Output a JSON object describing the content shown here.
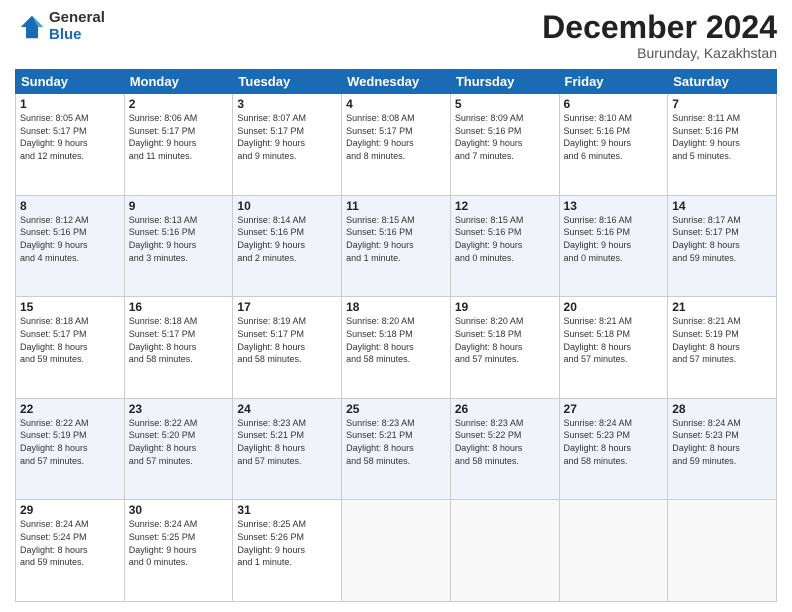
{
  "logo": {
    "general": "General",
    "blue": "Blue"
  },
  "header": {
    "month": "December 2024",
    "location": "Burunday, Kazakhstan"
  },
  "days_of_week": [
    "Sunday",
    "Monday",
    "Tuesday",
    "Wednesday",
    "Thursday",
    "Friday",
    "Saturday"
  ],
  "weeks": [
    [
      {
        "day": "1",
        "info": "Sunrise: 8:05 AM\nSunset: 5:17 PM\nDaylight: 9 hours\nand 12 minutes."
      },
      {
        "day": "2",
        "info": "Sunrise: 8:06 AM\nSunset: 5:17 PM\nDaylight: 9 hours\nand 11 minutes."
      },
      {
        "day": "3",
        "info": "Sunrise: 8:07 AM\nSunset: 5:17 PM\nDaylight: 9 hours\nand 9 minutes."
      },
      {
        "day": "4",
        "info": "Sunrise: 8:08 AM\nSunset: 5:17 PM\nDaylight: 9 hours\nand 8 minutes."
      },
      {
        "day": "5",
        "info": "Sunrise: 8:09 AM\nSunset: 5:16 PM\nDaylight: 9 hours\nand 7 minutes."
      },
      {
        "day": "6",
        "info": "Sunrise: 8:10 AM\nSunset: 5:16 PM\nDaylight: 9 hours\nand 6 minutes."
      },
      {
        "day": "7",
        "info": "Sunrise: 8:11 AM\nSunset: 5:16 PM\nDaylight: 9 hours\nand 5 minutes."
      }
    ],
    [
      {
        "day": "8",
        "info": "Sunrise: 8:12 AM\nSunset: 5:16 PM\nDaylight: 9 hours\nand 4 minutes."
      },
      {
        "day": "9",
        "info": "Sunrise: 8:13 AM\nSunset: 5:16 PM\nDaylight: 9 hours\nand 3 minutes."
      },
      {
        "day": "10",
        "info": "Sunrise: 8:14 AM\nSunset: 5:16 PM\nDaylight: 9 hours\nand 2 minutes."
      },
      {
        "day": "11",
        "info": "Sunrise: 8:15 AM\nSunset: 5:16 PM\nDaylight: 9 hours\nand 1 minute."
      },
      {
        "day": "12",
        "info": "Sunrise: 8:15 AM\nSunset: 5:16 PM\nDaylight: 9 hours\nand 0 minutes."
      },
      {
        "day": "13",
        "info": "Sunrise: 8:16 AM\nSunset: 5:16 PM\nDaylight: 9 hours\nand 0 minutes."
      },
      {
        "day": "14",
        "info": "Sunrise: 8:17 AM\nSunset: 5:17 PM\nDaylight: 8 hours\nand 59 minutes."
      }
    ],
    [
      {
        "day": "15",
        "info": "Sunrise: 8:18 AM\nSunset: 5:17 PM\nDaylight: 8 hours\nand 59 minutes."
      },
      {
        "day": "16",
        "info": "Sunrise: 8:18 AM\nSunset: 5:17 PM\nDaylight: 8 hours\nand 58 minutes."
      },
      {
        "day": "17",
        "info": "Sunrise: 8:19 AM\nSunset: 5:17 PM\nDaylight: 8 hours\nand 58 minutes."
      },
      {
        "day": "18",
        "info": "Sunrise: 8:20 AM\nSunset: 5:18 PM\nDaylight: 8 hours\nand 58 minutes."
      },
      {
        "day": "19",
        "info": "Sunrise: 8:20 AM\nSunset: 5:18 PM\nDaylight: 8 hours\nand 57 minutes."
      },
      {
        "day": "20",
        "info": "Sunrise: 8:21 AM\nSunset: 5:18 PM\nDaylight: 8 hours\nand 57 minutes."
      },
      {
        "day": "21",
        "info": "Sunrise: 8:21 AM\nSunset: 5:19 PM\nDaylight: 8 hours\nand 57 minutes."
      }
    ],
    [
      {
        "day": "22",
        "info": "Sunrise: 8:22 AM\nSunset: 5:19 PM\nDaylight: 8 hours\nand 57 minutes."
      },
      {
        "day": "23",
        "info": "Sunrise: 8:22 AM\nSunset: 5:20 PM\nDaylight: 8 hours\nand 57 minutes."
      },
      {
        "day": "24",
        "info": "Sunrise: 8:23 AM\nSunset: 5:21 PM\nDaylight: 8 hours\nand 57 minutes."
      },
      {
        "day": "25",
        "info": "Sunrise: 8:23 AM\nSunset: 5:21 PM\nDaylight: 8 hours\nand 58 minutes."
      },
      {
        "day": "26",
        "info": "Sunrise: 8:23 AM\nSunset: 5:22 PM\nDaylight: 8 hours\nand 58 minutes."
      },
      {
        "day": "27",
        "info": "Sunrise: 8:24 AM\nSunset: 5:23 PM\nDaylight: 8 hours\nand 58 minutes."
      },
      {
        "day": "28",
        "info": "Sunrise: 8:24 AM\nSunset: 5:23 PM\nDaylight: 8 hours\nand 59 minutes."
      }
    ],
    [
      {
        "day": "29",
        "info": "Sunrise: 8:24 AM\nSunset: 5:24 PM\nDaylight: 8 hours\nand 59 minutes."
      },
      {
        "day": "30",
        "info": "Sunrise: 8:24 AM\nSunset: 5:25 PM\nDaylight: 9 hours\nand 0 minutes."
      },
      {
        "day": "31",
        "info": "Sunrise: 8:25 AM\nSunset: 5:26 PM\nDaylight: 9 hours\nand 1 minute."
      },
      {
        "day": "",
        "info": ""
      },
      {
        "day": "",
        "info": ""
      },
      {
        "day": "",
        "info": ""
      },
      {
        "day": "",
        "info": ""
      }
    ]
  ]
}
